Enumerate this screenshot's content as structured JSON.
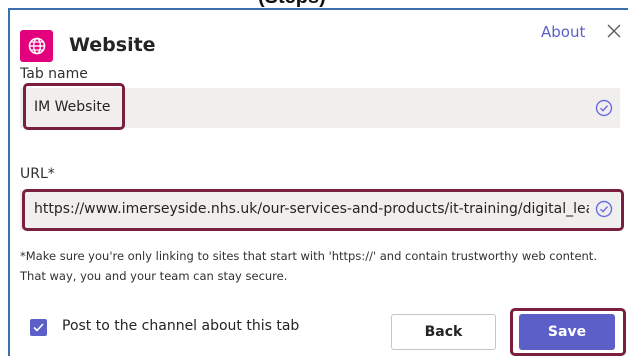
{
  "page_top_crop": "(Steps)",
  "dialog": {
    "title": "Website",
    "about_label": "About",
    "icons": {
      "app": "globe-icon",
      "close": "close-icon",
      "valid": "check-circle-icon",
      "checkbox": "checkmark-icon"
    },
    "accent_color": "#5b5fc7",
    "app_icon_color": "#e3007d",
    "highlight_color": "#7a1f3d"
  },
  "tab_name": {
    "label": "Tab name",
    "value": "IM Website"
  },
  "url": {
    "label": "URL*",
    "value": "https://www.imerseyside.nhs.uk/our-services-and-products/it-training/digital_lea"
  },
  "helper_text": {
    "line1": "*Make sure you're only linking to sites that start with 'https://' and contain trustworthy web content.",
    "line2": "That way, you and your team can stay secure."
  },
  "post_option": {
    "checked": true,
    "label": "Post to the channel about this tab"
  },
  "buttons": {
    "back": "Back",
    "save": "Save"
  }
}
